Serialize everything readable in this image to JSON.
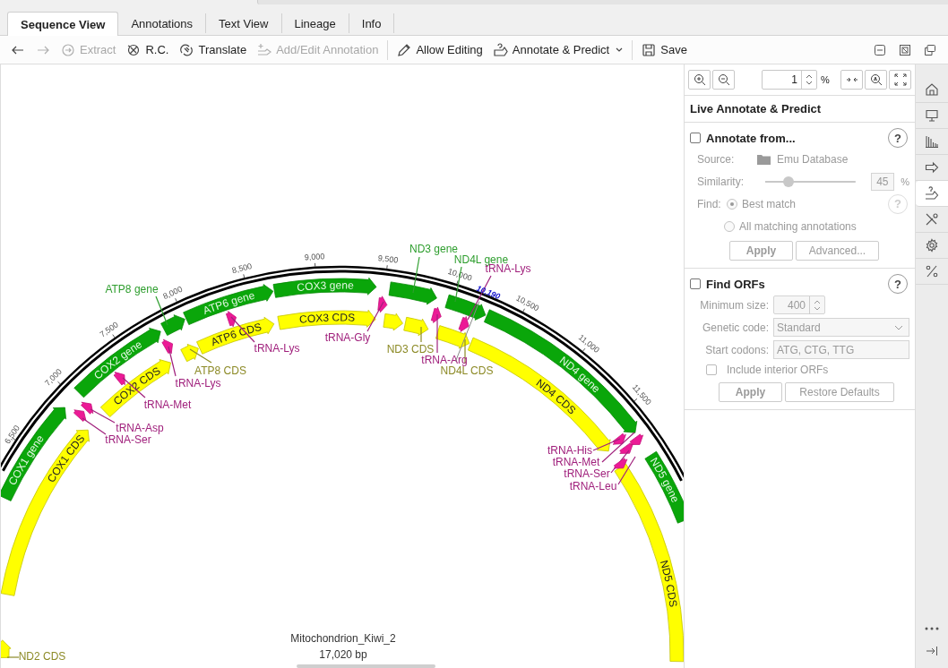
{
  "tabs": [
    {
      "label": "Sequence View",
      "selected": true
    },
    {
      "label": "Annotations",
      "selected": false
    },
    {
      "label": "Text View",
      "selected": false
    },
    {
      "label": "Lineage",
      "selected": false
    },
    {
      "label": "Info",
      "selected": false
    }
  ],
  "toolbar": [
    [
      {
        "kind": "back",
        "disabled": false
      },
      {
        "kind": "forward",
        "disabled": true
      },
      {
        "kind": "extract",
        "label": "Extract",
        "disabled": true
      },
      {
        "kind": "reverse-complement",
        "label": "R.C.",
        "disabled": false
      },
      {
        "kind": "translate",
        "label": "Translate",
        "disabled": false
      },
      {
        "kind": "add-annotation",
        "label": "Add/Edit Annotation",
        "disabled": true
      }
    ],
    [
      {
        "kind": "edit",
        "label": "Allow Editing",
        "disabled": false
      },
      {
        "kind": "annotate",
        "label": "Annotate & Predict",
        "disabled": false,
        "dropdown": true
      }
    ],
    [
      {
        "kind": "save",
        "label": "Save",
        "disabled": false
      }
    ]
  ],
  "map": {
    "name": "Mitochondrion_Kiwi_2",
    "length": "17,020 bp",
    "cursor": "10,190",
    "ticks": [
      "6,500",
      "7,000",
      "7,500",
      "8,000",
      "8,500",
      "9,000",
      "9,500",
      "10,000",
      "10,500",
      "11,000",
      "11,500"
    ],
    "features": [
      {
        "label": "COX1 gene",
        "kind": "gene"
      },
      {
        "label": "ATP8 gene",
        "kind": "gene"
      },
      {
        "label": "COX2 gene",
        "kind": "gene"
      },
      {
        "label": "ATP6 gene",
        "kind": "gene"
      },
      {
        "label": "COX3 gene",
        "kind": "gene"
      },
      {
        "label": "ND3 gene",
        "kind": "gene"
      },
      {
        "label": "ND4L gene",
        "kind": "gene"
      },
      {
        "label": "ND4 gene",
        "kind": "gene"
      },
      {
        "label": "ND5 gene",
        "kind": "gene"
      },
      {
        "label": "ND2 CDS",
        "kind": "cds"
      },
      {
        "label": "COX1 CDS",
        "kind": "cds"
      },
      {
        "label": "COX2 CDS",
        "kind": "cds"
      },
      {
        "label": "ATP6 CDS",
        "kind": "cds"
      },
      {
        "label": "ATP8 CDS",
        "kind": "cds"
      },
      {
        "label": "COX3 CDS",
        "kind": "cds"
      },
      {
        "label": "ND3 CDS",
        "kind": "cds"
      },
      {
        "label": "ND4L CDS",
        "kind": "cds"
      },
      {
        "label": "ND4 CDS",
        "kind": "cds"
      },
      {
        "label": "ND5 CDS",
        "kind": "cds"
      },
      {
        "label": "tRNA-Asp",
        "kind": "trna"
      },
      {
        "label": "tRNA-Ser",
        "kind": "trna"
      },
      {
        "label": "tRNA-Met",
        "kind": "trna"
      },
      {
        "label": "tRNA-Lys",
        "kind": "trna"
      },
      {
        "label": "tRNA-Lys",
        "kind": "trna"
      },
      {
        "label": "tRNA-Gly",
        "kind": "trna"
      },
      {
        "label": "tRNA-Arg",
        "kind": "trna"
      },
      {
        "label": "tRNA-Lys",
        "kind": "trna"
      },
      {
        "label": "tRNA-His",
        "kind": "trna"
      },
      {
        "label": "tRNA-Met",
        "kind": "trna"
      },
      {
        "label": "tRNA-Ser",
        "kind": "trna"
      },
      {
        "label": "tRNA-Leu",
        "kind": "trna"
      }
    ]
  },
  "zoom": {
    "value": "1",
    "unit": "%"
  },
  "panel": {
    "title": "Live Annotate & Predict",
    "annotate": {
      "label": "Annotate from...",
      "checked": false,
      "disabled": true,
      "help": "?",
      "source_label": "Source:",
      "source": "Emu Database",
      "similarity_label": "Similarity:",
      "level": 0.26,
      "similarity": "45",
      "unit": "%",
      "find_label": "Find:",
      "find_help": "?",
      "options": [
        {
          "label": "Best match",
          "selected": true
        },
        {
          "label": "All matching annotations",
          "selected": false
        }
      ],
      "buttons": [
        "Apply",
        "Advanced..."
      ]
    },
    "orfs": {
      "label": "Find ORFs",
      "checked": false,
      "disabled": true,
      "help": "?",
      "min_label": "Minimum size:",
      "min": "400",
      "code_label": "Genetic code:",
      "code": "Standard",
      "codons_label": "Start codons:",
      "codons": "ATG, CTG, TTG",
      "interior": {
        "label": "Include interior ORFs",
        "checked": false
      },
      "buttons": [
        "Apply",
        "Restore Defaults"
      ]
    }
  },
  "sidebar": [
    {
      "kind": "home",
      "selected": false
    },
    {
      "kind": "monitor",
      "selected": false
    },
    {
      "kind": "chart",
      "selected": false
    },
    {
      "kind": "arrow",
      "selected": false
    },
    {
      "kind": "annotate",
      "selected": true
    },
    {
      "kind": "scissors",
      "selected": false
    },
    {
      "kind": "gear",
      "selected": false
    },
    {
      "kind": "percent",
      "selected": false
    }
  ]
}
